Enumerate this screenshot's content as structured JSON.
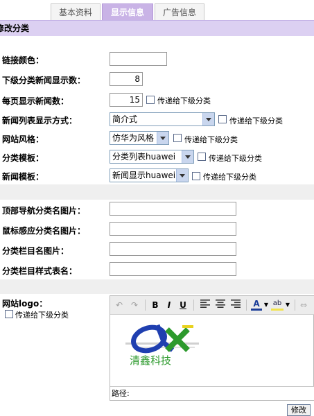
{
  "tabs": [
    {
      "label": "基本资料"
    },
    {
      "label": "显示信息"
    },
    {
      "label": "广告信息"
    }
  ],
  "section_title": "修改分类",
  "fields": {
    "link_color": {
      "label": "链接颜色：",
      "value": ""
    },
    "sub_news_count": {
      "label": "下级分类新闻显示数：",
      "value": "8"
    },
    "per_page": {
      "label": "每页显示新闻数：",
      "value": "15"
    },
    "list_style": {
      "label": "新闻列表显示方式：",
      "value": "简介式"
    },
    "site_style": {
      "label": "网站风格：",
      "value": "仿华为风格"
    },
    "category_template": {
      "label": "分类模板：",
      "value": "分类列表huawei"
    },
    "news_template": {
      "label": "新闻模板：",
      "value": "新闻显示huawei"
    },
    "top_nav_image": {
      "label": "顶部导航分类名图片：",
      "value": ""
    },
    "hover_image": {
      "label": "鼠标感应分类名图片：",
      "value": ""
    },
    "column_image": {
      "label": "分类栏目名图片：",
      "value": ""
    },
    "column_css": {
      "label": "分类栏目样式表名：",
      "value": ""
    },
    "site_logo": {
      "label": "网站logo："
    }
  },
  "inherit_label": "传递给下级分类",
  "editor": {
    "toolbar": {
      "bold": "B",
      "italic": "I",
      "underline": "U",
      "font_color": "A",
      "highlight": "ab"
    },
    "logo_text": "清鑫科技",
    "status_label": "路径:"
  },
  "submit_label": "修改",
  "colors": {
    "accent": "#c9b3e6",
    "title_bg": "#dcd0f2"
  }
}
